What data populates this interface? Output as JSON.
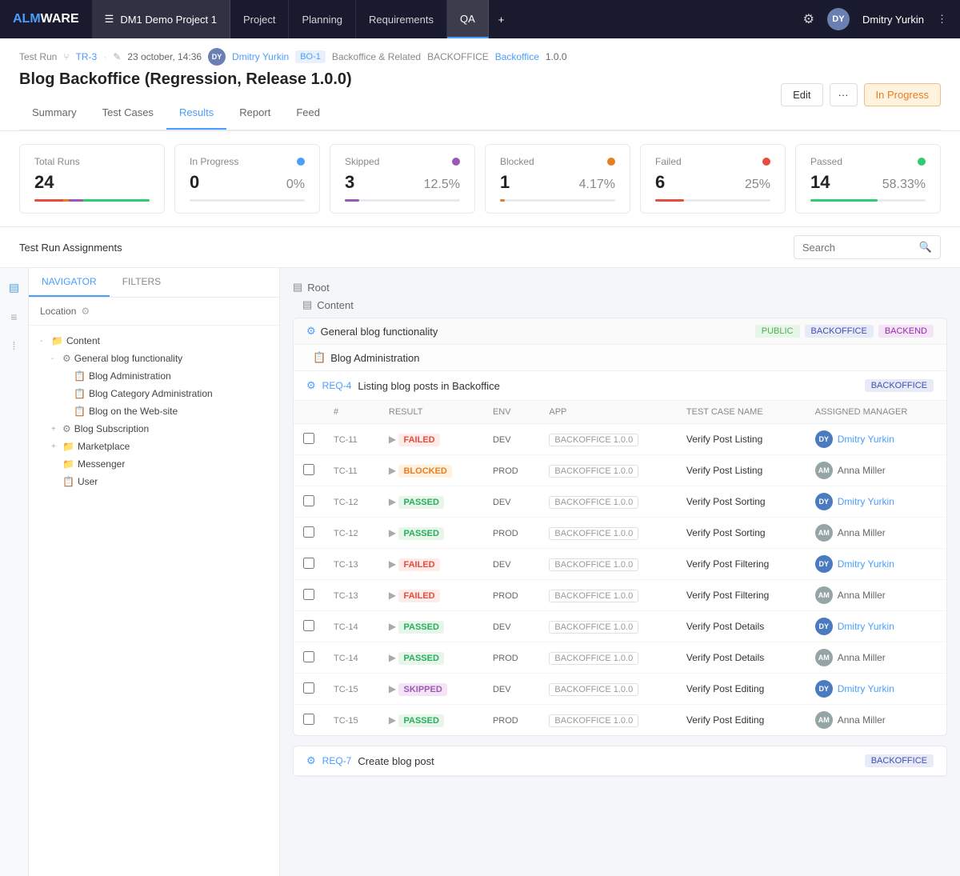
{
  "app": {
    "logo_alm": "ALM",
    "logo_ware": "WARE"
  },
  "topnav": {
    "project_icon": "☰",
    "project_name": "DM1 Demo Project 1",
    "items": [
      {
        "label": "Project",
        "active": false
      },
      {
        "label": "Planning",
        "active": false
      },
      {
        "label": "Requirements",
        "active": false
      },
      {
        "label": "QA",
        "active": true
      },
      {
        "label": "+",
        "active": false
      }
    ],
    "gear_icon": "⚙",
    "user_name": "Dmitry Yurkin",
    "dots_icon": "⋮"
  },
  "run_header": {
    "label": "Test Run",
    "run_id": "TR-3",
    "edit_icon": "✎",
    "date": "23 october, 14:36",
    "assignee": "Dmitry Yurkin",
    "badge": "BO-1",
    "backoffice_text": "Backoffice & Related",
    "backoffice_label": "BACKOFFICE",
    "link": "Backoffice",
    "version": "1.0.0",
    "title": "Blog Backoffice (Regression, Release 1.0.0)",
    "btn_edit": "Edit",
    "btn_more": "···",
    "btn_status": "In Progress"
  },
  "stats": [
    {
      "label": "Total Runs",
      "num": "24",
      "pct": "",
      "dot_class": ""
    },
    {
      "label": "In Progress",
      "num": "0",
      "pct": "0%",
      "dot_class": "dot-blue"
    },
    {
      "label": "Skipped",
      "num": "3",
      "pct": "12.5%",
      "dot_class": "dot-purple"
    },
    {
      "label": "Blocked",
      "num": "1",
      "pct": "4.17%",
      "dot_class": "dot-orange"
    },
    {
      "label": "Failed",
      "num": "6",
      "pct": "25%",
      "dot_class": "dot-red"
    },
    {
      "label": "Passed",
      "num": "14",
      "pct": "58.33%",
      "dot_class": "dot-green"
    }
  ],
  "tabs": [
    {
      "label": "Summary",
      "active": false
    },
    {
      "label": "Test Cases",
      "active": false
    },
    {
      "label": "Results",
      "active": true
    },
    {
      "label": "Report",
      "active": false
    },
    {
      "label": "Feed",
      "active": false
    }
  ],
  "section_title": "Test Run Assignments",
  "search": {
    "placeholder": "Search",
    "icon": "🔍"
  },
  "navigator": {
    "tabs": [
      {
        "label": "NAVIGATOR",
        "active": true
      },
      {
        "label": "FILTERS",
        "active": false
      }
    ],
    "location_label": "Location",
    "tree": [
      {
        "indent": 1,
        "toggle": "-",
        "icon": "📁",
        "label": "Content",
        "type": "folder"
      },
      {
        "indent": 2,
        "toggle": "-",
        "icon": "⚙",
        "label": "General blog functionality",
        "type": "req"
      },
      {
        "indent": 3,
        "toggle": "",
        "icon": "📋",
        "label": "Blog Administration",
        "type": "item"
      },
      {
        "indent": 3,
        "toggle": "",
        "icon": "📋",
        "label": "Blog Category Administration",
        "type": "item"
      },
      {
        "indent": 3,
        "toggle": "",
        "icon": "📋",
        "label": "Blog on the Web-site",
        "type": "item"
      },
      {
        "indent": 2,
        "toggle": "+",
        "icon": "⚙",
        "label": "Blog Subscription",
        "type": "req"
      },
      {
        "indent": 2,
        "toggle": "+",
        "icon": "📁",
        "label": "Marketplace",
        "type": "folder"
      },
      {
        "indent": 2,
        "toggle": "",
        "icon": "📁",
        "label": "Messenger",
        "type": "folder"
      },
      {
        "indent": 2,
        "toggle": "",
        "icon": "📋",
        "label": "User",
        "type": "item"
      }
    ]
  },
  "results": {
    "root_label": "Root",
    "content_label": "Content",
    "section_label": "General blog functionality",
    "section_tags": [
      "PUBLIC",
      "BACKOFFICE",
      "BACKEND"
    ],
    "blog_admin_label": "Blog Administration",
    "req4": {
      "id": "REQ-4",
      "title": "Listing blog posts in Backoffice",
      "tag": "BACKOFFICE",
      "columns": [
        "#",
        "RESULT",
        "ENV",
        "APP",
        "TEST CASE NAME",
        "ASSIGNED MANAGER"
      ],
      "rows": [
        {
          "tc": "TC-11",
          "result": "FAILED",
          "result_class": "result-failed",
          "env": "DEV",
          "app": "BACKOFFICE 1.0.0",
          "name": "Verify Post Listing",
          "assignee": "Dmitry Yurkin",
          "av_class": "av-blue",
          "av_text": "DY"
        },
        {
          "tc": "TC-11",
          "result": "BLOCKED",
          "result_class": "result-blocked",
          "env": "PROD",
          "app": "BACKOFFICE 1.0.0",
          "name": "Verify Post Listing",
          "assignee": "Anna Miller",
          "av_class": "av-gray",
          "av_text": "AM"
        },
        {
          "tc": "TC-12",
          "result": "PASSED",
          "result_class": "result-passed",
          "env": "DEV",
          "app": "BACKOFFICE 1.0.0",
          "name": "Verify Post Sorting",
          "assignee": "Dmitry Yurkin",
          "av_class": "av-blue",
          "av_text": "DY"
        },
        {
          "tc": "TC-12",
          "result": "PASSED",
          "result_class": "result-passed",
          "env": "PROD",
          "app": "BACKOFFICE 1.0.0",
          "name": "Verify Post Sorting",
          "assignee": "Anna Miller",
          "av_class": "av-gray",
          "av_text": "AM"
        },
        {
          "tc": "TC-13",
          "result": "FAILED",
          "result_class": "result-failed",
          "env": "DEV",
          "app": "BACKOFFICE 1.0.0",
          "name": "Verify Post Filtering",
          "assignee": "Dmitry Yurkin",
          "av_class": "av-blue",
          "av_text": "DY"
        },
        {
          "tc": "TC-13",
          "result": "FAILED",
          "result_class": "result-failed",
          "env": "PROD",
          "app": "BACKOFFICE 1.0.0",
          "name": "Verify Post Filtering",
          "assignee": "Anna Miller",
          "av_class": "av-gray",
          "av_text": "AM"
        },
        {
          "tc": "TC-14",
          "result": "PASSED",
          "result_class": "result-passed",
          "env": "DEV",
          "app": "BACKOFFICE 1.0.0",
          "name": "Verify Post Details",
          "assignee": "Dmitry Yurkin",
          "av_class": "av-blue",
          "av_text": "DY"
        },
        {
          "tc": "TC-14",
          "result": "PASSED",
          "result_class": "result-passed",
          "env": "PROD",
          "app": "BACKOFFICE 1.0.0",
          "name": "Verify Post Details",
          "assignee": "Anna Miller",
          "av_class": "av-gray",
          "av_text": "AM"
        },
        {
          "tc": "TC-15",
          "result": "SKIPPED",
          "result_class": "result-skipped",
          "env": "DEV",
          "app": "BACKOFFICE 1.0.0",
          "name": "Verify Post Editing",
          "assignee": "Dmitry Yurkin",
          "av_class": "av-blue",
          "av_text": "DY"
        },
        {
          "tc": "TC-15",
          "result": "PASSED",
          "result_class": "result-passed",
          "env": "PROD",
          "app": "BACKOFFICE 1.0.0",
          "name": "Verify Post Editing",
          "assignee": "Anna Miller",
          "av_class": "av-gray",
          "av_text": "AM"
        }
      ]
    },
    "req7": {
      "id": "REQ-7",
      "title": "Create blog post",
      "tag": "BACKOFFICE"
    }
  }
}
